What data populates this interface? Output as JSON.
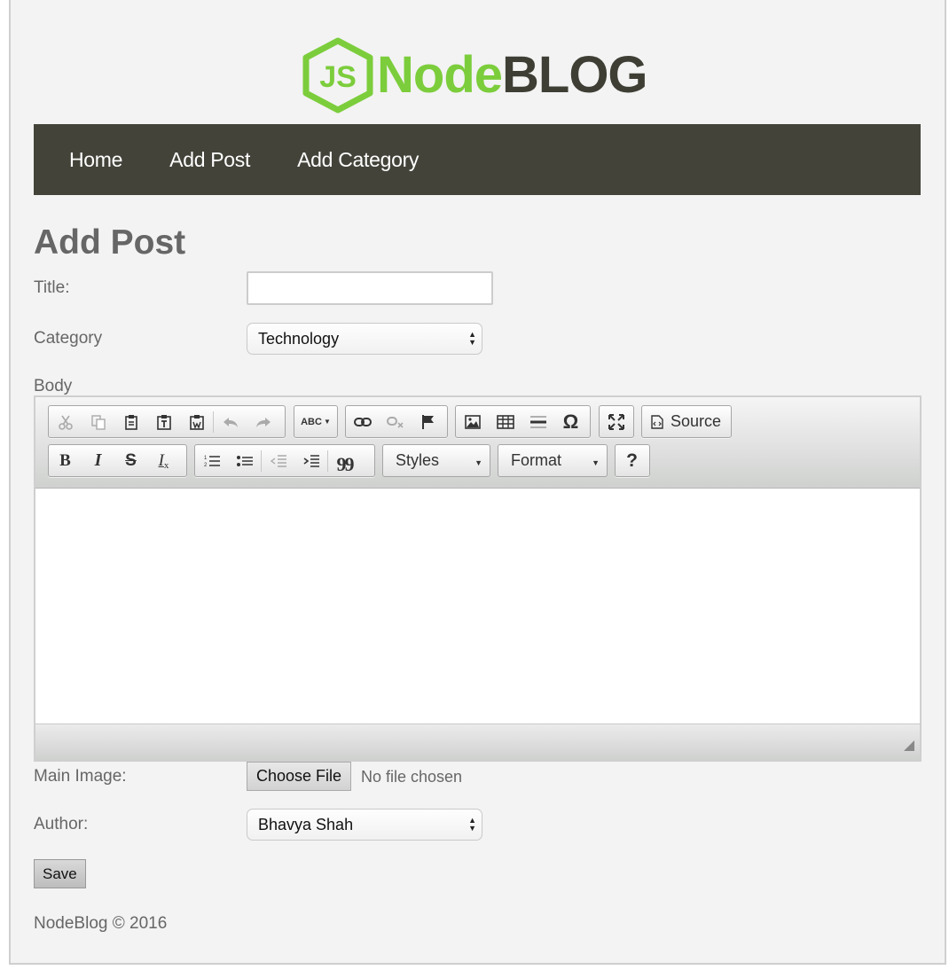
{
  "logo": {
    "js_mark": "JS",
    "node": "Node",
    "blog": "BLOG"
  },
  "nav": {
    "items": [
      "Home",
      "Add Post",
      "Add Category"
    ]
  },
  "page_title": "Add Post",
  "form": {
    "title_label": "Title:",
    "title_value": "",
    "category_label": "Category",
    "category_selected": "Technology",
    "body_label": "Body",
    "main_image_label": "Main Image:",
    "choose_file_label": "Choose File",
    "no_file_text": "No file chosen",
    "author_label": "Author:",
    "author_selected": "Bhavya Shah",
    "save_label": "Save"
  },
  "editor": {
    "source_label": "Source",
    "styles_label": "Styles",
    "format_label": "Format",
    "help_label": "?",
    "spell_label": "ABC",
    "omega_label": "Ω",
    "quote_label": "99"
  },
  "footer": "NodeBlog © 2016",
  "colors": {
    "navbar": "#43433a",
    "logo_green": "#7ccd3c",
    "logo_dark": "#3e3e35"
  }
}
